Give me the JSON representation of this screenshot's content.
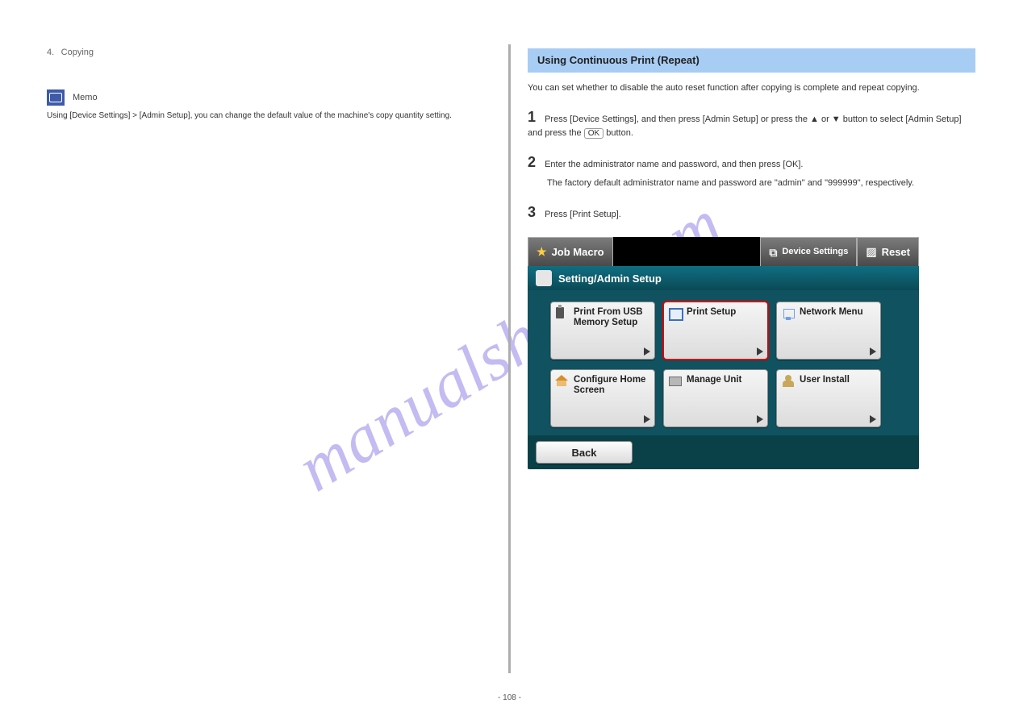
{
  "left": {
    "section_number": "4.",
    "section_title": "Copying",
    "memo_label": "Memo",
    "memo_text": "Using [Device Settings] > [Admin Setup], you can change the default value of the machine's copy quantity setting."
  },
  "right": {
    "blue_bar": "Using Continuous Print (Repeat)",
    "para1": "You can set whether to disable the auto reset function after copying is complete and repeat copying.",
    "step_num": "1",
    "step_text_a": "Press [Device Settings], and then press [Admin Setup] or press the ▲ or ▼ button to select [Admin Setup] and press the ",
    "step_ok": "OK",
    "step_text_b": " button.",
    "step2_num": "2",
    "step2_text": "Enter the administrator name and password, and then press [OK].",
    "step2_extra": "The factory default administrator name and password are \"admin\" and \"999999\", respectively.",
    "step3_num": "3",
    "step3_text": "Press [Print Setup]."
  },
  "device": {
    "tab_jobmacro": "Job Macro",
    "tab_devset": "Device Settings",
    "tab_reset": "Reset",
    "mid_title": "Setting/Admin Setup",
    "tiles": [
      {
        "label": "Print From USB Memory Setup",
        "icon": "ic-usb",
        "name": "tile-print-from-usb"
      },
      {
        "label": "Print Setup",
        "icon": "ic-print",
        "selected": true,
        "name": "tile-print-setup"
      },
      {
        "label": "Network Menu",
        "icon": "ic-net",
        "name": "tile-network-menu"
      },
      {
        "label": "Configure Home Screen",
        "icon": "ic-home",
        "name": "tile-configure-home"
      },
      {
        "label": "Manage Unit",
        "icon": "ic-mgr",
        "name": "tile-manage-unit"
      },
      {
        "label": "User Install",
        "icon": "ic-user",
        "name": "tile-user-install"
      }
    ],
    "back": "Back"
  },
  "footer": {
    "page": "- 108 -"
  },
  "watermark": "manualshive.com"
}
